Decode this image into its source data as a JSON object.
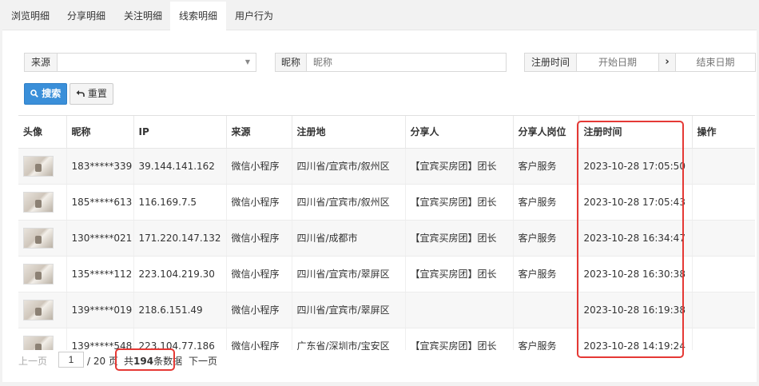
{
  "tabs": [
    {
      "label": "浏览明细",
      "active": false
    },
    {
      "label": "分享明细",
      "active": false
    },
    {
      "label": "关注明细",
      "active": false
    },
    {
      "label": "线索明细",
      "active": true
    },
    {
      "label": "用户行为",
      "active": false
    }
  ],
  "filters": {
    "source_label": "来源",
    "source_value": "",
    "nickname_label": "昵称",
    "nickname_placeholder": "昵称",
    "regtime_label": "注册时间",
    "start_placeholder": "开始日期",
    "date_sep_icon": "chevron-right-icon",
    "end_placeholder": "结束日期"
  },
  "buttons": {
    "search": "搜索",
    "search_icon": "search-icon",
    "reset": "重置",
    "reset_icon": "undo-icon"
  },
  "table": {
    "headers": [
      "头像",
      "昵称",
      "IP",
      "来源",
      "注册地",
      "分享人",
      "分享人岗位",
      "注册时间",
      "操作"
    ],
    "rows": [
      {
        "nickname": "183*****339",
        "ip": "39.144.141.162",
        "source": "微信小程序",
        "region": "四川省/宜宾市/叙州区",
        "sharer": "【宜宾买房团】团长",
        "position": "客户服务",
        "regtime": "2023-10-28 17:05:50",
        "action": ""
      },
      {
        "nickname": "185*****613",
        "ip": "116.169.7.5",
        "source": "微信小程序",
        "region": "四川省/宜宾市/叙州区",
        "sharer": "【宜宾买房团】团长",
        "position": "客户服务",
        "regtime": "2023-10-28 17:05:43",
        "action": ""
      },
      {
        "nickname": "130*****021",
        "ip": "171.220.147.132",
        "source": "微信小程序",
        "region": "四川省/成都市",
        "sharer": "【宜宾买房团】团长",
        "position": "客户服务",
        "regtime": "2023-10-28 16:34:47",
        "action": ""
      },
      {
        "nickname": "135*****112",
        "ip": "223.104.219.30",
        "source": "微信小程序",
        "region": "四川省/宜宾市/翠屏区",
        "sharer": "【宜宾买房团】团长",
        "position": "客户服务",
        "regtime": "2023-10-28 16:30:38",
        "action": ""
      },
      {
        "nickname": "139*****019",
        "ip": "218.6.151.49",
        "source": "微信小程序",
        "region": "四川省/宜宾市/翠屏区",
        "sharer": "",
        "position": "",
        "regtime": "2023-10-28 16:19:38",
        "action": ""
      },
      {
        "nickname": "139*****548",
        "ip": "223.104.77.186",
        "source": "微信小程序",
        "region": "广东省/深圳市/宝安区",
        "sharer": "【宜宾买房团】团长",
        "position": "客户服务",
        "regtime": "2023-10-28 14:19:24",
        "action": ""
      }
    ]
  },
  "pager": {
    "prev": "上一页",
    "current_page": "1",
    "total_pages": "/ 20 页",
    "total_prefix": "共",
    "total_count": "194",
    "total_suffix": "条数据",
    "next": "下一页"
  },
  "colors": {
    "highlight": "#e53935",
    "primary": "#3a8fd9"
  }
}
